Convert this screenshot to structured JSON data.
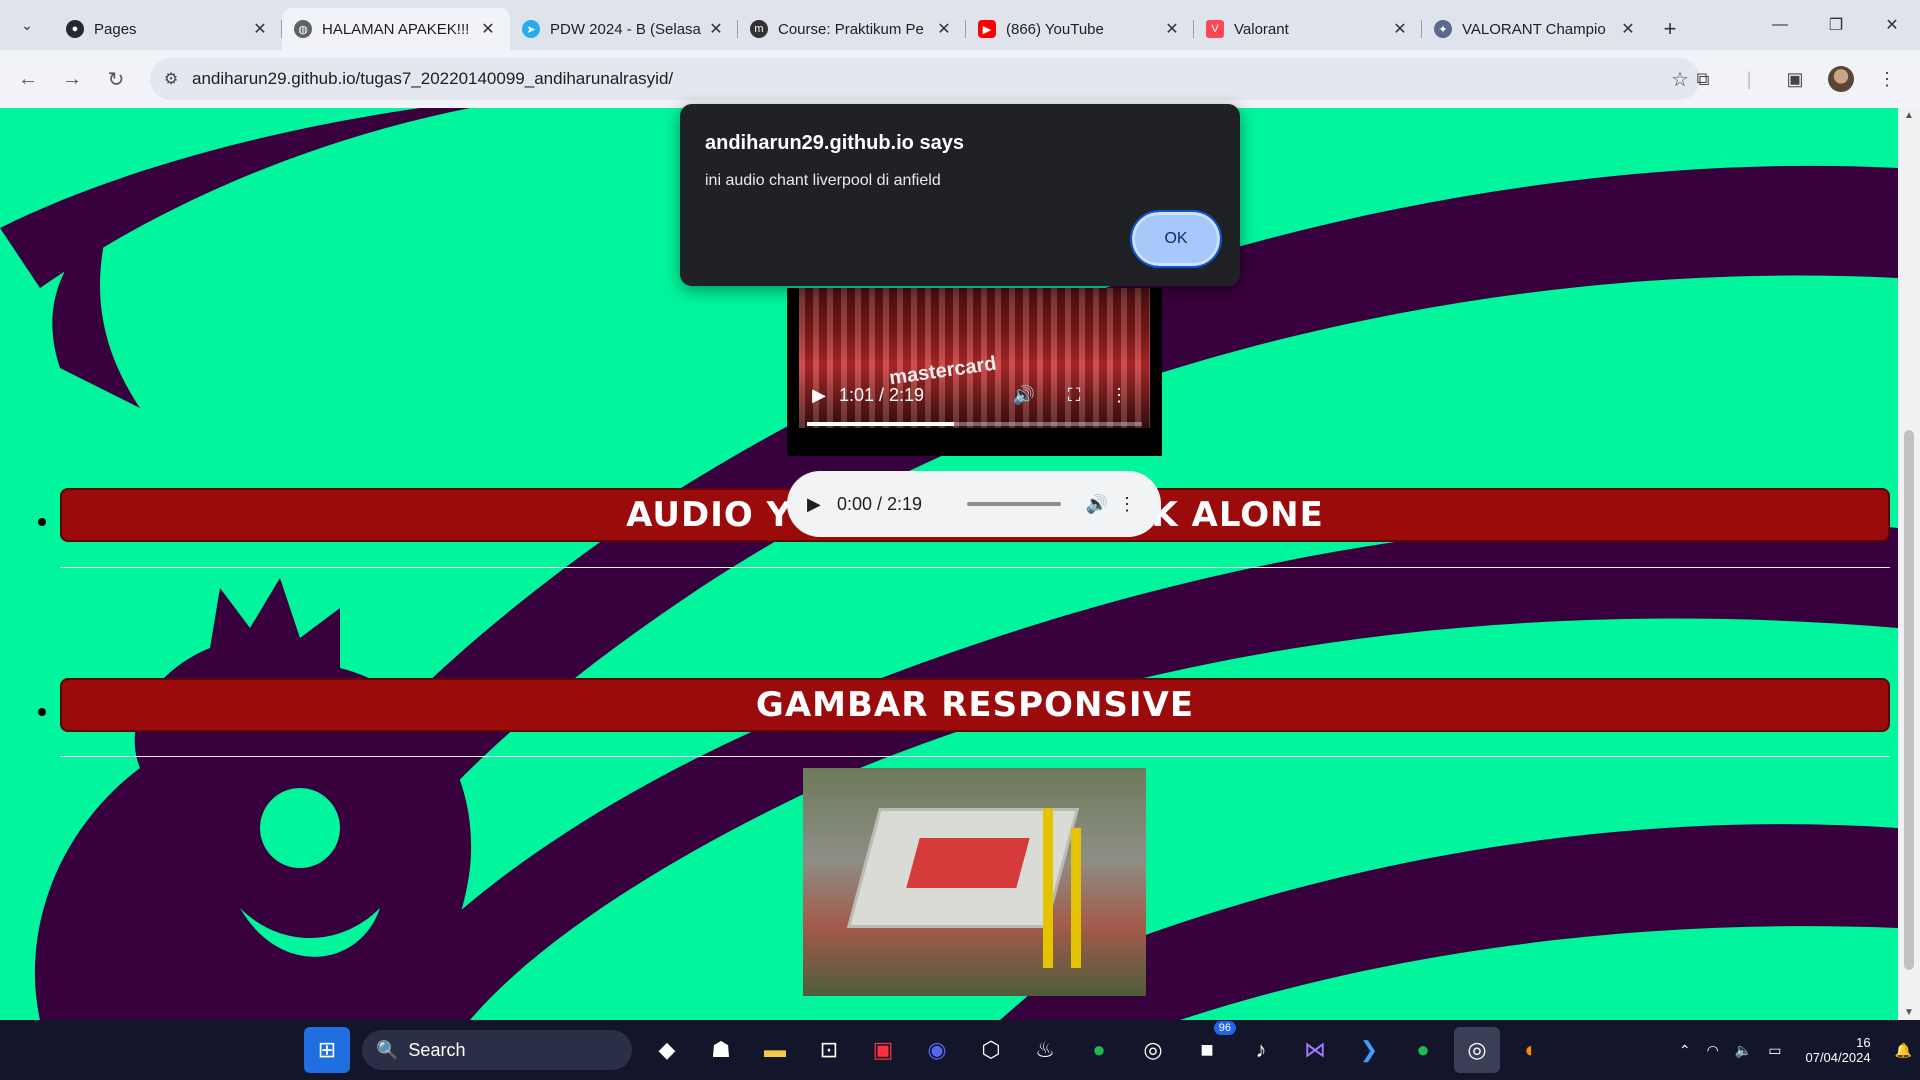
{
  "browser": {
    "tabs": [
      {
        "title": "Pages",
        "icon": "github-icon",
        "color": "#24292f"
      },
      {
        "title": "HALAMAN APAKEK!!!",
        "icon": "globe-icon",
        "color": "#5f6368"
      },
      {
        "title": "PDW 2024 - B (Selasa",
        "icon": "telegram-icon",
        "color": "#2aabee"
      },
      {
        "title": "Course: Praktikum Pe",
        "icon": "moodle-icon",
        "color": "#333333"
      },
      {
        "title": "(866) YouTube",
        "icon": "youtube-icon",
        "color": "#ff0000"
      },
      {
        "title": "Valorant",
        "icon": "valorant-icon",
        "color": "#ff4655"
      },
      {
        "title": "VALORANT Champio",
        "icon": "valorant-champions-icon",
        "color": "#5a6a8a"
      }
    ],
    "url": "andiharun29.github.io/tugas7_20220140099_andiharunalrasyid/"
  },
  "dialog": {
    "title": "andiharun29.github.io says",
    "message": "ini audio chant liverpool di anfield",
    "ok_label": "OK"
  },
  "page": {
    "video": {
      "time": "1:01 / 2:19",
      "progress_fraction": 0.44,
      "banner_text": "mastercard"
    },
    "sections": [
      {
        "heading": "AUDIO YOU'LL NEVER WALK ALONE"
      },
      {
        "heading": "GAMBAR RESPONSIVE"
      }
    ],
    "audio": {
      "time": "0:00 / 2:19"
    }
  },
  "taskbar": {
    "search_label": "Search",
    "badge_count": "96",
    "date": "07/04/2024",
    "time_partial": "16"
  },
  "colors": {
    "page_bg": "#00f59c",
    "heading_bar": "#9c0b0b",
    "lion_purple": "#38003c"
  }
}
